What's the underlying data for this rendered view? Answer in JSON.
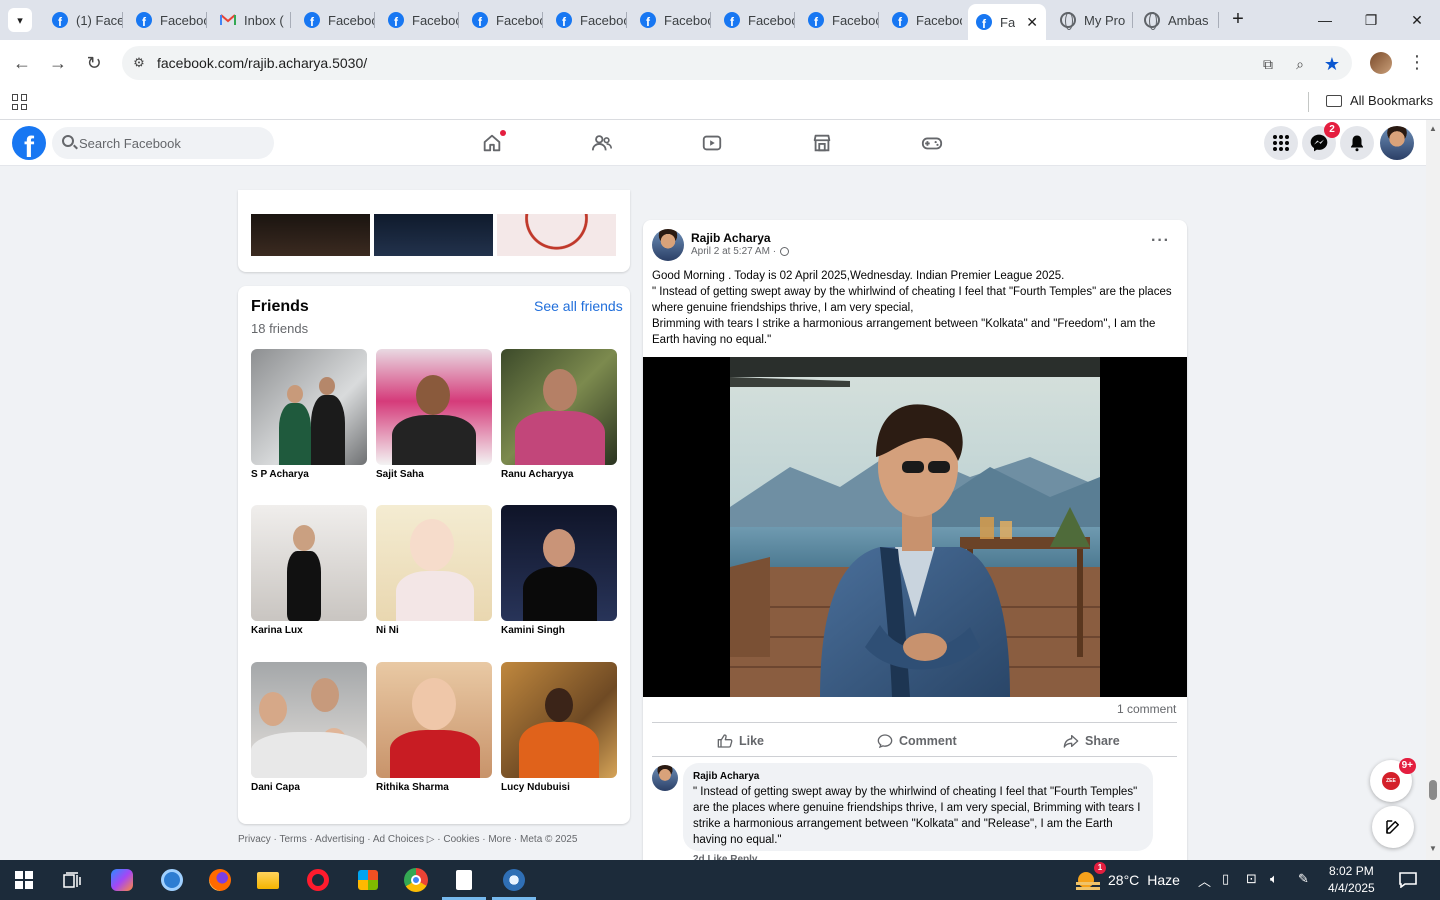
{
  "browser": {
    "tabs": [
      {
        "label": "(1) Face",
        "icon": "facebook-icon"
      },
      {
        "label": "Facebook",
        "icon": "facebook-icon"
      },
      {
        "label": "Inbox (",
        "icon": "gmail-icon"
      },
      {
        "label": "Facebook",
        "icon": "facebook-icon"
      },
      {
        "label": "Facebook",
        "icon": "facebook-icon"
      },
      {
        "label": "Facebook",
        "icon": "facebook-icon"
      },
      {
        "label": "Facebook",
        "icon": "facebook-icon"
      },
      {
        "label": "Facebook",
        "icon": "facebook-icon"
      },
      {
        "label": "Facebook",
        "icon": "facebook-icon"
      },
      {
        "label": "Facebook",
        "icon": "facebook-icon"
      },
      {
        "label": "Facebook",
        "icon": "facebook-icon"
      },
      {
        "label": "Fa",
        "icon": "facebook-icon",
        "active": true
      },
      {
        "label": "My Pro",
        "icon": "globe-icon"
      },
      {
        "label": "Ambas",
        "icon": "globe-icon"
      }
    ],
    "url": "facebook.com/rajib.acharya.5030/",
    "bookmarks_label": "All Bookmarks"
  },
  "fb": {
    "search_placeholder": "Search Facebook",
    "messenger_badge": "2",
    "brand_color": "#1877f2"
  },
  "profile": {
    "name": "Rajib Acharya",
    "more_label": "···"
  },
  "friends": {
    "title": "Friends",
    "count": "18 friends",
    "see_all": "See all friends",
    "items": [
      {
        "name": "S P Acharya"
      },
      {
        "name": "Sajit Saha"
      },
      {
        "name": "Ranu Acharyya"
      },
      {
        "name": "Karina Lux"
      },
      {
        "name": "Ni Ni"
      },
      {
        "name": "Kamini Singh"
      },
      {
        "name": "Dani Capa"
      },
      {
        "name": "Rithika Sharma"
      },
      {
        "name": "Lucy Ndubuisi"
      }
    ]
  },
  "footer": "Privacy · Terms · Advertising · Ad Choices ▷ · Cookies · More · Meta © 2025",
  "post": {
    "author": "Rajib Acharya",
    "time": "April 2 at 5:27 AM ·",
    "more_label": "···",
    "text_lines": [
      "Good Morning . Today is 02 April 2025,Wednesday. Indian Premier League 2025.",
      "\" Instead of getting swept away by the whirlwind of cheating I feel that \"Fourth Temples\" are the places where genuine friendships thrive, I am very special,",
      "Brimming with tears I strike a harmonious arrangement between \"Kolkata\" and \"Freedom\", I am the Earth having no equal.\""
    ],
    "comment_count": "1 comment",
    "actions": {
      "like": "Like",
      "comment": "Comment",
      "share": "Share"
    },
    "comment": {
      "author": "Rajib Acharya",
      "text": "\" Instead of getting swept away by the whirlwind of cheating I feel that \"Fourth Temples\" are the places where genuine friendships thrive, I am very special, Brimming with tears I strike a harmonious arrangement between \"Kolkata\" and \"Release\", I am the Earth having no equal.\"",
      "meta": "2d    Like    Reply"
    }
  },
  "floating": {
    "news_badge": "9+",
    "news_logo": "ZEE NEWS"
  },
  "taskbar": {
    "weather_temp": "28°C",
    "weather_cond": "Haze",
    "weather_badge": "1",
    "time": "8:02 PM",
    "date": "4/4/2025"
  }
}
